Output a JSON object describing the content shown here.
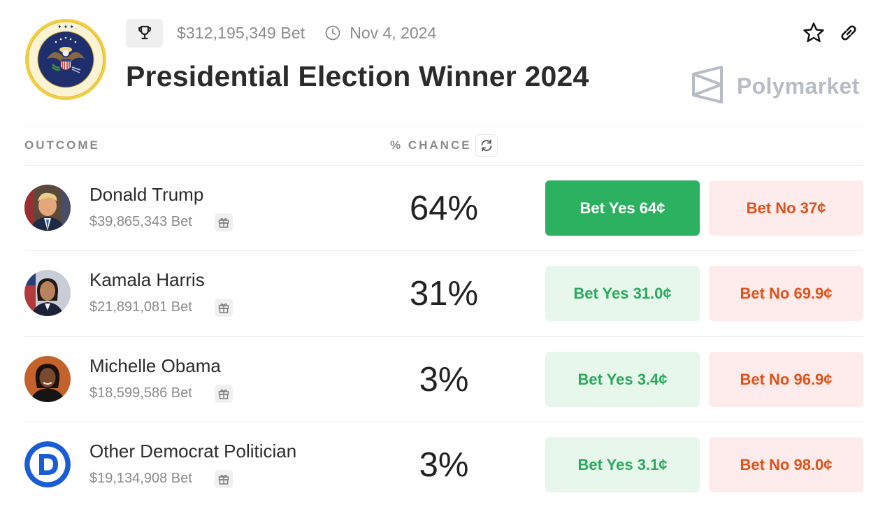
{
  "header": {
    "volume": "$312,195,349 Bet",
    "date": "Nov 4, 2024",
    "title": "Presidential Election Winner 2024",
    "brand": "Polymarket"
  },
  "table": {
    "col_outcome": "OUTCOME",
    "col_chance": "% CHANCE"
  },
  "outcomes": [
    {
      "name": "Donald Trump",
      "volume": "$39,865,343 Bet",
      "chance": "64%",
      "yes_label": "Bet Yes 64¢",
      "no_label": "Bet No 37¢"
    },
    {
      "name": "Kamala Harris",
      "volume": "$21,891,081 Bet",
      "chance": "31%",
      "yes_label": "Bet Yes 31.0¢",
      "no_label": "Bet No 69.9¢"
    },
    {
      "name": "Michelle Obama",
      "volume": "$18,599,586 Bet",
      "chance": "3%",
      "yes_label": "Bet Yes 3.4¢",
      "no_label": "Bet No 96.9¢"
    },
    {
      "name": "Other Democrat Politician",
      "volume": "$19,134,908 Bet",
      "chance": "3%",
      "yes_label": "Bet Yes 3.1¢",
      "no_label": "Bet No 98.0¢"
    }
  ],
  "icons": [
    "presidential-seal-icon",
    "trophy-icon",
    "clock-icon",
    "star-icon",
    "link-icon",
    "polymarket-logo-icon",
    "refresh-icon",
    "gift-icon",
    "democrat-d-icon"
  ],
  "colors": {
    "yes_active": "#2bb15f",
    "yes_bg": "#e8f7ec",
    "yes_text": "#2aaa5c",
    "no_bg": "#fdeceb",
    "no_text": "#e0521a",
    "dem_blue": "#1a5cd6"
  }
}
